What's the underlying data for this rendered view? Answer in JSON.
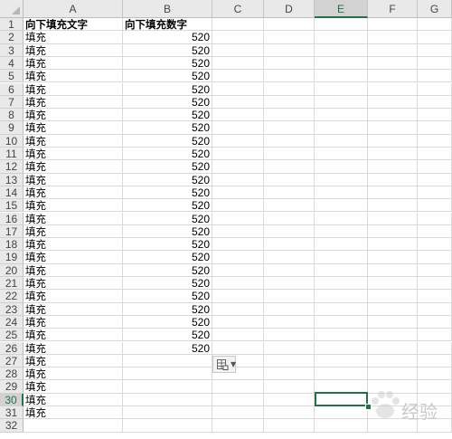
{
  "columns": [
    "A",
    "B",
    "C",
    "D",
    "E",
    "F",
    "G"
  ],
  "selected_column": "E",
  "selected_row": 30,
  "rows": [
    {
      "n": "1",
      "a": "向下填充文字",
      "b": "向下填充数字"
    },
    {
      "n": "2",
      "a": "填充",
      "b": "520"
    },
    {
      "n": "3",
      "a": "填充",
      "b": "520"
    },
    {
      "n": "4",
      "a": "填充",
      "b": "520"
    },
    {
      "n": "5",
      "a": "填充",
      "b": "520"
    },
    {
      "n": "6",
      "a": "填充",
      "b": "520"
    },
    {
      "n": "7",
      "a": "填充",
      "b": "520"
    },
    {
      "n": "8",
      "a": "填充",
      "b": "520"
    },
    {
      "n": "9",
      "a": "填充",
      "b": "520"
    },
    {
      "n": "10",
      "a": "填充",
      "b": "520"
    },
    {
      "n": "11",
      "a": "填充",
      "b": "520"
    },
    {
      "n": "12",
      "a": "填充",
      "b": "520"
    },
    {
      "n": "13",
      "a": "填充",
      "b": "520"
    },
    {
      "n": "14",
      "a": "填充",
      "b": "520"
    },
    {
      "n": "15",
      "a": "填充",
      "b": "520"
    },
    {
      "n": "16",
      "a": "填充",
      "b": "520"
    },
    {
      "n": "17",
      "a": "填充",
      "b": "520"
    },
    {
      "n": "18",
      "a": "填充",
      "b": "520"
    },
    {
      "n": "19",
      "a": "填充",
      "b": "520"
    },
    {
      "n": "20",
      "a": "填充",
      "b": "520"
    },
    {
      "n": "21",
      "a": "填充",
      "b": "520"
    },
    {
      "n": "22",
      "a": "填充",
      "b": "520"
    },
    {
      "n": "23",
      "a": "填充",
      "b": "520"
    },
    {
      "n": "24",
      "a": "填充",
      "b": "520"
    },
    {
      "n": "25",
      "a": "填充",
      "b": "520"
    },
    {
      "n": "26",
      "a": "填充",
      "b": "520"
    },
    {
      "n": "27",
      "a": "填充",
      "b": ""
    },
    {
      "n": "28",
      "a": "填充",
      "b": ""
    },
    {
      "n": "29",
      "a": "填充",
      "b": ""
    },
    {
      "n": "30",
      "a": "填充",
      "b": ""
    },
    {
      "n": "31",
      "a": "填充",
      "b": ""
    },
    {
      "n": "32",
      "a": "",
      "b": ""
    }
  ],
  "autofill_options": {
    "icon": "autofill-options-icon",
    "dropdown": "chevron-down-icon"
  },
  "watermark": {
    "text": "经验",
    "icon": "paw-icon"
  },
  "colors": {
    "accent": "#217346",
    "header_bg": "#e9e9e9",
    "grid": "#d9d9d9"
  }
}
